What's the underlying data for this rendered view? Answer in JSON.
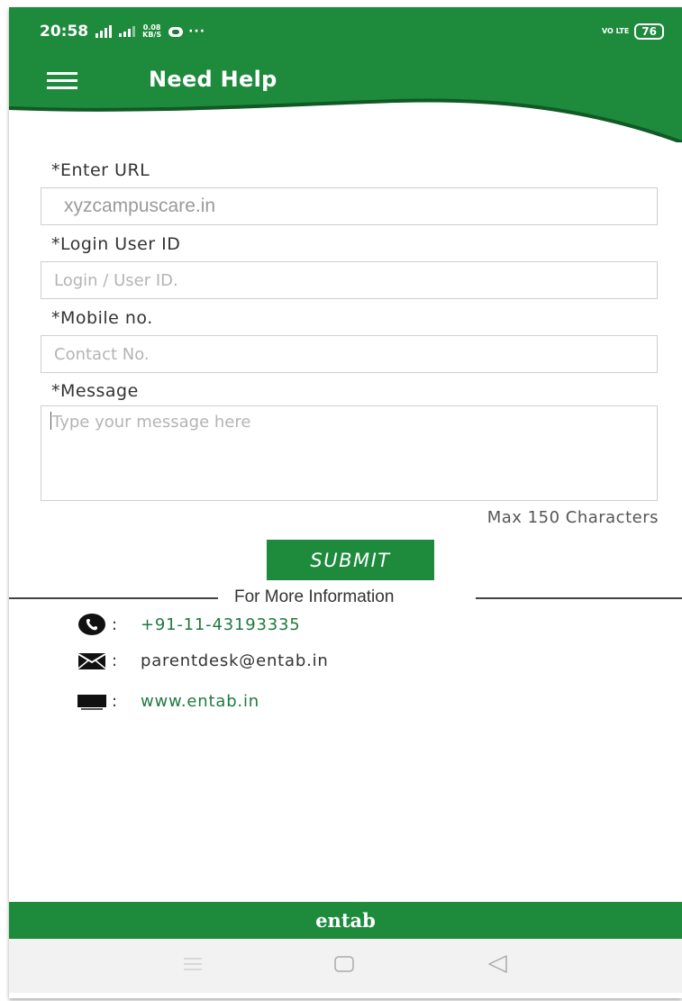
{
  "status_bar": {
    "time": "20:58",
    "net_speed_top": "0.08",
    "net_speed_bottom": "KB/S",
    "more": "···",
    "volte": "VO LTE",
    "battery": "76"
  },
  "header": {
    "title": "Need Help",
    "color": "#1e8a3c"
  },
  "form": {
    "url_label": "*Enter URL",
    "url_value": "xyzcampuscare.in",
    "login_label": "*Login User ID",
    "login_placeholder": "Login / User ID.",
    "mobile_label": "*Mobile no.",
    "mobile_placeholder": "Contact No.",
    "message_label": "*Message",
    "message_placeholder": "Type your message here",
    "max_chars": "Max 150 Characters",
    "submit_label": "SUBMIT"
  },
  "info": {
    "title": "For More Information",
    "items": [
      {
        "icon": "phone-icon",
        "separator": ":",
        "value": "+91-11-43193335"
      },
      {
        "icon": "mail-icon",
        "separator": ":",
        "value": "parentdesk@entab.in"
      },
      {
        "icon": "monitor-icon",
        "separator": ":",
        "value": "www.entab.in"
      }
    ]
  },
  "footer": {
    "brand": "entab"
  }
}
